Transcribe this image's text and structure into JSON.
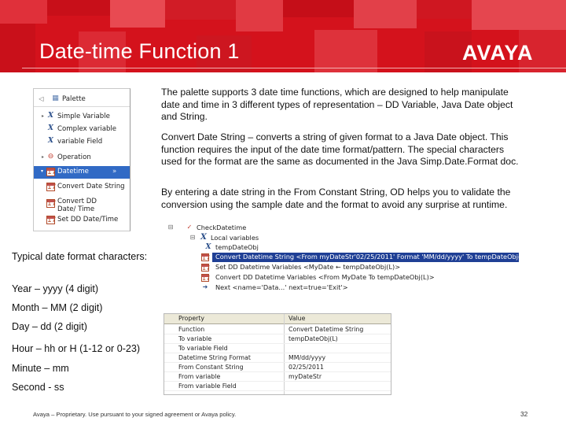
{
  "slide": {
    "title": "Date-time Function 1",
    "logo": "AVAYA",
    "paragraphs": [
      "The palette supports 3 date time functions, which are designed to help manipulate date and time in 3 different types of representation – DD Variable, Java Date object and String.",
      "Convert Date String – converts a string of given format to a Java Date object. This function requires the input of the date time format/pattern. The special characters used for the format are the same as documented in the Java Simp.Date.Format doc.",
      "By entering a date string in the From Constant String, OD helps you to validate the conversion using the sample date and the format to avoid any surprise at runtime."
    ],
    "formats": {
      "heading": "Typical date format characters:",
      "year": "Year – yyyy (4 digit)",
      "month": "Month – MM (2 digit)",
      "day": "Day – dd (2 digit)",
      "hour": "Hour – hh or H (1-12 or 0-23)",
      "minute": "Minute – mm",
      "second": "Second - ss"
    },
    "footer": "Avaya – Proprietary. Use pursuant to your signed agreement or Avaya policy.",
    "page_number": "32"
  },
  "palette": {
    "items": [
      {
        "label": "Palette",
        "icon": "palette-icon"
      },
      {
        "label": "Simple Variable",
        "icon": "x-variable-icon"
      },
      {
        "label": "Complex variable",
        "icon": "x-variable-icon"
      },
      {
        "label": "variable Field",
        "icon": "x-variable-icon"
      },
      {
        "label": "Operation",
        "icon": "operation-icon"
      },
      {
        "label": "Datetime",
        "icon": "calendar-icon"
      },
      {
        "label": "Convert Date String",
        "icon": "calendar-icon"
      },
      {
        "label": "Convert DD Date/ Time",
        "icon": "calendar-icon"
      },
      {
        "label": "Set DD Date/Time",
        "icon": "calendar-icon"
      }
    ],
    "collapse_glyph": "»"
  },
  "tree": {
    "rows": [
      {
        "label": "CheckDatetime"
      },
      {
        "label": "Local variables"
      },
      {
        "label": "tempDateObj"
      },
      {
        "label": "Convert Datetime String <From myDateStr'02/25/2011' Format 'MM/dd/yyyy' To tempDateObj(L)>"
      },
      {
        "label": "Set DD Datetime Variables <MyDate ← tempDateObj(L)>"
      },
      {
        "label": "Convert DD Datetime Variables <From MyDate To tempDateObj(L)>"
      },
      {
        "label": "Next <name='Data...' next=true='Exit'>"
      }
    ]
  },
  "properties": {
    "headers": [
      "Property",
      "Value"
    ],
    "rows": [
      {
        "key": "Function",
        "value": "Convert Datetime String"
      },
      {
        "key": "To variable",
        "value": "tempDateObj(L)"
      },
      {
        "key": "To variable Field",
        "value": ""
      },
      {
        "key": "Datetime String Format",
        "value": "MM/dd/yyyy"
      },
      {
        "key": "From Constant String",
        "value": "02/25/2011"
      },
      {
        "key": "From variable",
        "value": "myDateStr"
      },
      {
        "key": "From variable Field",
        "value": ""
      }
    ]
  },
  "colors": {
    "brand_red": "#d4121c",
    "selection_blue": "#316ac5"
  }
}
